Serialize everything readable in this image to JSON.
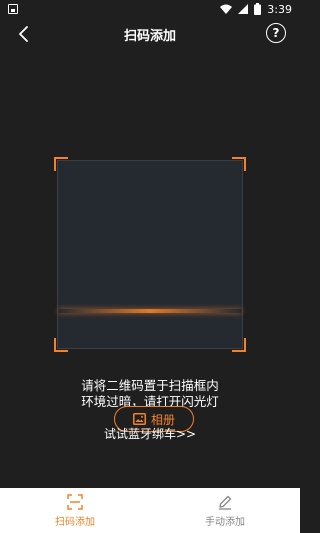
{
  "status_bar": {
    "time": "3:39",
    "icons": [
      "image-icon",
      "wifi-icon",
      "signal-icon",
      "battery-icon"
    ]
  },
  "header": {
    "title": "扫码添加",
    "back_icon": "back-icon",
    "help_label": "?"
  },
  "scanner": {
    "hint_line1": "请将二维码置于扫描框内",
    "hint_line2": "环境过暗，请打开闪光灯"
  },
  "album_button": {
    "label": "相册",
    "icon": "image-icon"
  },
  "bluetooth_link": "试试蓝牙绑车>>",
  "bottom_tabs": [
    {
      "label": "扫码添加",
      "icon": "scan-icon",
      "active": true
    },
    {
      "label": "手动添加",
      "icon": "edit-icon",
      "active": false
    }
  ],
  "colors": {
    "accent": "#f5822a",
    "background": "#1f1f1f",
    "scan_bg": "#252a31",
    "tab_bar": "#ffffff"
  }
}
